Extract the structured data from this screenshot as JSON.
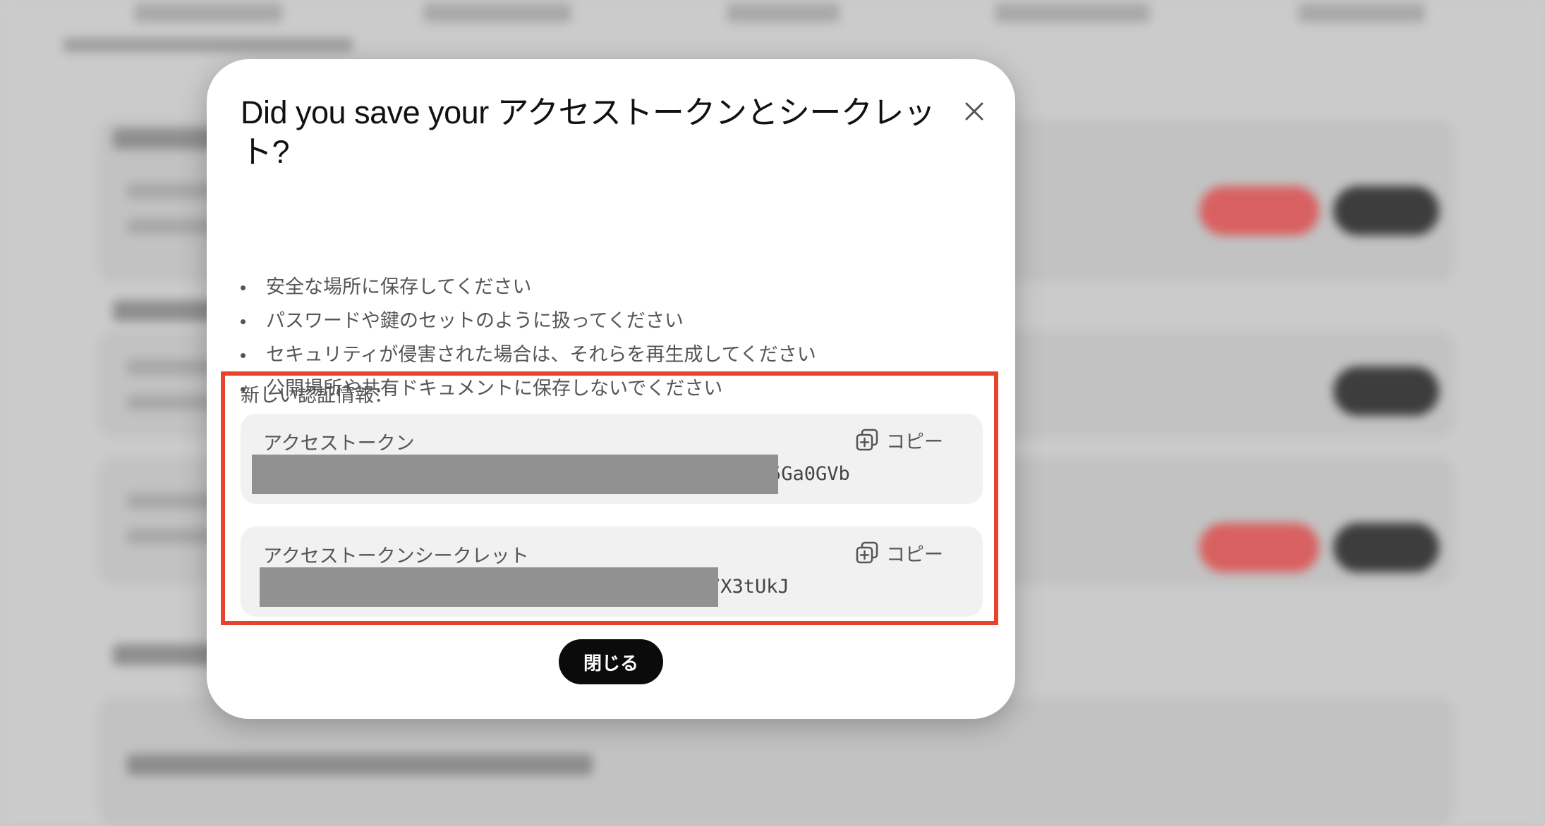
{
  "modal": {
    "title": "Did you save your アクセストークンとシークレット?",
    "bullets": [
      "安全な場所に保存してください",
      "パスワードや鍵のセットのように扱ってください",
      "セキュリティが侵害された場合は、それらを再生成してください",
      "公開場所や共有ドキュメントに保存しないでください"
    ],
    "credentials_heading": "新しい認証情報：",
    "access_token": {
      "label": "アクセストークン",
      "copy_label": "コピー",
      "visible_suffix": "5Ga0GVb"
    },
    "access_token_secret": {
      "label": "アクセストークンシークレット",
      "copy_label": "コピー",
      "visible_suffix": "7X3tUkJ"
    },
    "close_button": "閉じる"
  },
  "colors": {
    "highlight_border": "#e8432c",
    "primary_button": "#0b0b0b",
    "card_background": "#f1f1f1",
    "redaction": "#919191"
  },
  "icons": {
    "close": "close-icon",
    "copy": "copy-icon"
  }
}
